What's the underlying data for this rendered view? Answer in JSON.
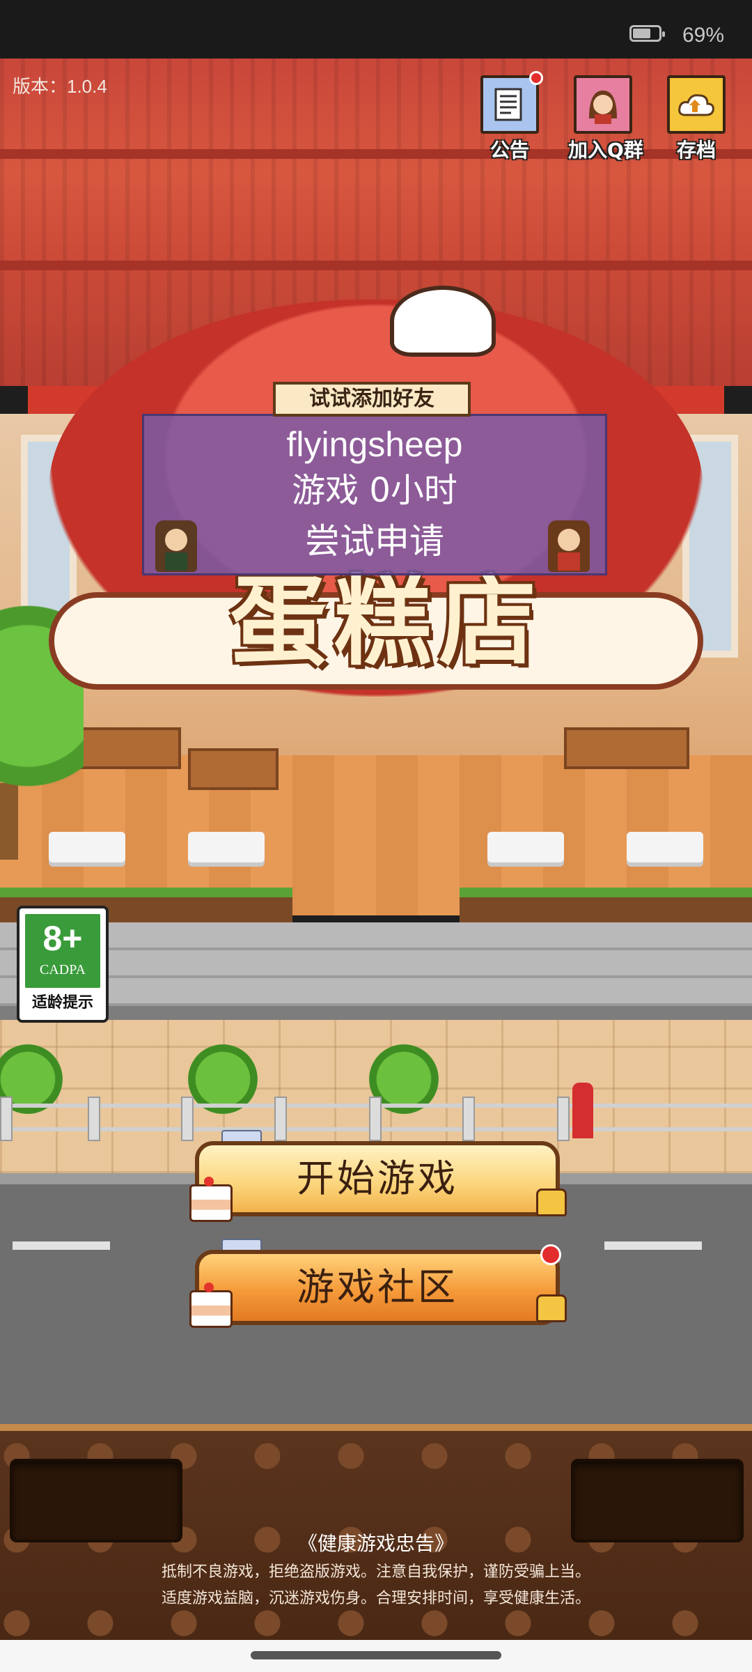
{
  "status_bar": {
    "battery_percent": "69%",
    "battery_level": 0.69
  },
  "version_label": "版本：1.0.4",
  "top_buttons": [
    {
      "label": "公告",
      "icon": "document-icon",
      "has_badge": true
    },
    {
      "label": "加入Q群",
      "icon": "girl-avatar-icon",
      "has_badge": false
    },
    {
      "label": "存档",
      "icon": "cloud-save-icon",
      "has_badge": false
    }
  ],
  "logo_text": "蛋糕店",
  "friend_popup": {
    "banner": "试试添加好友",
    "name": "flyingsheep",
    "playtime": "游戏 0小时",
    "action": "尝试申请"
  },
  "age_rating": {
    "age": "8+",
    "org": "CADPA",
    "tip": "适龄提示"
  },
  "main_buttons": {
    "start": "开始游戏",
    "community": "游戏社区"
  },
  "health_notice": {
    "title": "《健康游戏忠告》",
    "line1": "抵制不良游戏，拒绝盗版游戏。注意自我保护，谨防受骗上当。",
    "line2": "适度游戏益脑，沉迷游戏伤身。合理安排时间，享受健康生活。"
  },
  "colors": {
    "roof": "#d7573f",
    "popup": "#785caa",
    "start_button": "#fbd47a",
    "community_button": "#f59a3a",
    "badge_red": "#e32d2d"
  }
}
